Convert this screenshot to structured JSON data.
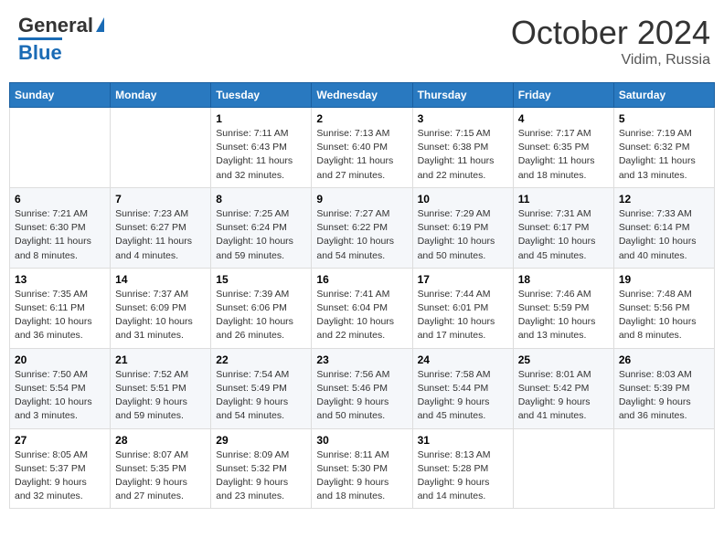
{
  "header": {
    "logo_line1": "General",
    "logo_line2": "Blue",
    "month": "October 2024",
    "location": "Vidim, Russia"
  },
  "days_of_week": [
    "Sunday",
    "Monday",
    "Tuesday",
    "Wednesday",
    "Thursday",
    "Friday",
    "Saturday"
  ],
  "weeks": [
    [
      {
        "day": "",
        "info": ""
      },
      {
        "day": "",
        "info": ""
      },
      {
        "day": "1",
        "info": "Sunrise: 7:11 AM\nSunset: 6:43 PM\nDaylight: 11 hours and 32 minutes."
      },
      {
        "day": "2",
        "info": "Sunrise: 7:13 AM\nSunset: 6:40 PM\nDaylight: 11 hours and 27 minutes."
      },
      {
        "day": "3",
        "info": "Sunrise: 7:15 AM\nSunset: 6:38 PM\nDaylight: 11 hours and 22 minutes."
      },
      {
        "day": "4",
        "info": "Sunrise: 7:17 AM\nSunset: 6:35 PM\nDaylight: 11 hours and 18 minutes."
      },
      {
        "day": "5",
        "info": "Sunrise: 7:19 AM\nSunset: 6:32 PM\nDaylight: 11 hours and 13 minutes."
      }
    ],
    [
      {
        "day": "6",
        "info": "Sunrise: 7:21 AM\nSunset: 6:30 PM\nDaylight: 11 hours and 8 minutes."
      },
      {
        "day": "7",
        "info": "Sunrise: 7:23 AM\nSunset: 6:27 PM\nDaylight: 11 hours and 4 minutes."
      },
      {
        "day": "8",
        "info": "Sunrise: 7:25 AM\nSunset: 6:24 PM\nDaylight: 10 hours and 59 minutes."
      },
      {
        "day": "9",
        "info": "Sunrise: 7:27 AM\nSunset: 6:22 PM\nDaylight: 10 hours and 54 minutes."
      },
      {
        "day": "10",
        "info": "Sunrise: 7:29 AM\nSunset: 6:19 PM\nDaylight: 10 hours and 50 minutes."
      },
      {
        "day": "11",
        "info": "Sunrise: 7:31 AM\nSunset: 6:17 PM\nDaylight: 10 hours and 45 minutes."
      },
      {
        "day": "12",
        "info": "Sunrise: 7:33 AM\nSunset: 6:14 PM\nDaylight: 10 hours and 40 minutes."
      }
    ],
    [
      {
        "day": "13",
        "info": "Sunrise: 7:35 AM\nSunset: 6:11 PM\nDaylight: 10 hours and 36 minutes."
      },
      {
        "day": "14",
        "info": "Sunrise: 7:37 AM\nSunset: 6:09 PM\nDaylight: 10 hours and 31 minutes."
      },
      {
        "day": "15",
        "info": "Sunrise: 7:39 AM\nSunset: 6:06 PM\nDaylight: 10 hours and 26 minutes."
      },
      {
        "day": "16",
        "info": "Sunrise: 7:41 AM\nSunset: 6:04 PM\nDaylight: 10 hours and 22 minutes."
      },
      {
        "day": "17",
        "info": "Sunrise: 7:44 AM\nSunset: 6:01 PM\nDaylight: 10 hours and 17 minutes."
      },
      {
        "day": "18",
        "info": "Sunrise: 7:46 AM\nSunset: 5:59 PM\nDaylight: 10 hours and 13 minutes."
      },
      {
        "day": "19",
        "info": "Sunrise: 7:48 AM\nSunset: 5:56 PM\nDaylight: 10 hours and 8 minutes."
      }
    ],
    [
      {
        "day": "20",
        "info": "Sunrise: 7:50 AM\nSunset: 5:54 PM\nDaylight: 10 hours and 3 minutes."
      },
      {
        "day": "21",
        "info": "Sunrise: 7:52 AM\nSunset: 5:51 PM\nDaylight: 9 hours and 59 minutes."
      },
      {
        "day": "22",
        "info": "Sunrise: 7:54 AM\nSunset: 5:49 PM\nDaylight: 9 hours and 54 minutes."
      },
      {
        "day": "23",
        "info": "Sunrise: 7:56 AM\nSunset: 5:46 PM\nDaylight: 9 hours and 50 minutes."
      },
      {
        "day": "24",
        "info": "Sunrise: 7:58 AM\nSunset: 5:44 PM\nDaylight: 9 hours and 45 minutes."
      },
      {
        "day": "25",
        "info": "Sunrise: 8:01 AM\nSunset: 5:42 PM\nDaylight: 9 hours and 41 minutes."
      },
      {
        "day": "26",
        "info": "Sunrise: 8:03 AM\nSunset: 5:39 PM\nDaylight: 9 hours and 36 minutes."
      }
    ],
    [
      {
        "day": "27",
        "info": "Sunrise: 8:05 AM\nSunset: 5:37 PM\nDaylight: 9 hours and 32 minutes."
      },
      {
        "day": "28",
        "info": "Sunrise: 8:07 AM\nSunset: 5:35 PM\nDaylight: 9 hours and 27 minutes."
      },
      {
        "day": "29",
        "info": "Sunrise: 8:09 AM\nSunset: 5:32 PM\nDaylight: 9 hours and 23 minutes."
      },
      {
        "day": "30",
        "info": "Sunrise: 8:11 AM\nSunset: 5:30 PM\nDaylight: 9 hours and 18 minutes."
      },
      {
        "day": "31",
        "info": "Sunrise: 8:13 AM\nSunset: 5:28 PM\nDaylight: 9 hours and 14 minutes."
      },
      {
        "day": "",
        "info": ""
      },
      {
        "day": "",
        "info": ""
      }
    ]
  ]
}
